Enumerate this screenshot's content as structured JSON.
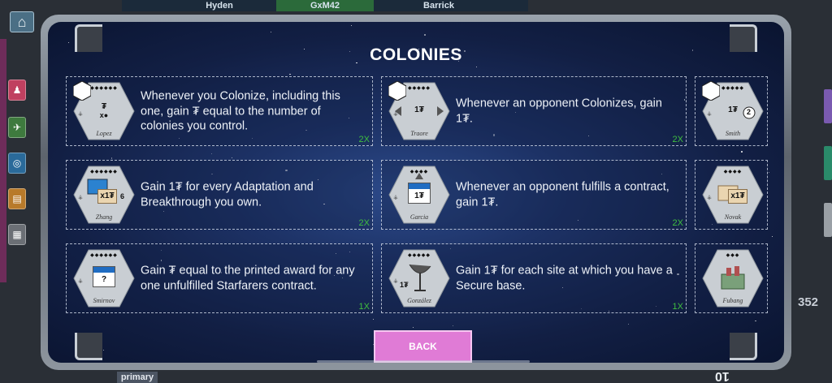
{
  "topbar": {
    "tabs": [
      {
        "label": "Hyden"
      },
      {
        "label": "GxM42"
      },
      {
        "label": "Barrick"
      }
    ]
  },
  "board": {
    "primary_label": "primary",
    "right_number": "352",
    "bottom_number": "10"
  },
  "modal": {
    "title": "COLONIES",
    "back_label": "BACK",
    "cards": [
      {
        "text": "Whenever you Colonize, including this one, gain ₮ equal to the number of colonies you control.",
        "count": "2X",
        "tile_name": "Lopez",
        "tile_symbol": "₮",
        "tile_dots": "◆◆◆◆◆◆"
      },
      {
        "text": "Whenever an opponent Colonizes, gain 1₮.",
        "count": "2X",
        "tile_name": "Traore",
        "tile_symbol": "1₮",
        "tile_dots": "◆◆◆◆◆"
      },
      {
        "text": "",
        "count": "",
        "tile_name": "Smith",
        "tile_symbol": "1₮",
        "tile_badge": "2",
        "tile_dots": "◆◆◆◆◆"
      },
      {
        "text": "Gain 1₮ for every Adaptation and Breakthrough you own.",
        "count": "2X",
        "tile_name": "Zhang",
        "tile_symbol": "x1₮",
        "tile_badge": "6",
        "tile_dots": "◆◆◆◆◆◆"
      },
      {
        "text": "Whenever an opponent fulfills a contract, gain 1₮.",
        "count": "2X",
        "tile_name": "Garcia",
        "tile_symbol": "1₮",
        "tile_dots": "◆◆◆◆"
      },
      {
        "text": "",
        "count": "",
        "tile_name": "Novak",
        "tile_symbol": "x1₮",
        "tile_dots": "◆◆◆◆"
      },
      {
        "text": "Gain ₮ equal to the printed award for any one unfulfilled Starfarers contract.",
        "count": "1X",
        "tile_name": "Smirnov",
        "tile_symbol": "?",
        "tile_dots": "◆◆◆◆◆◆"
      },
      {
        "text": "Gain 1₮ for each site at which you have a Secure base.",
        "count": "1X",
        "tile_name": "González",
        "tile_symbol": "1₮",
        "tile_dots": "◆◆◆◆◆"
      },
      {
        "text": "",
        "count": "",
        "tile_name": "Fubang",
        "tile_symbol": "",
        "tile_dots": "◆◆◆"
      }
    ]
  },
  "colors": {
    "back_button": "#e07bd6",
    "count_text": "#3fbf3f",
    "modal_bg": "#1d3266"
  }
}
